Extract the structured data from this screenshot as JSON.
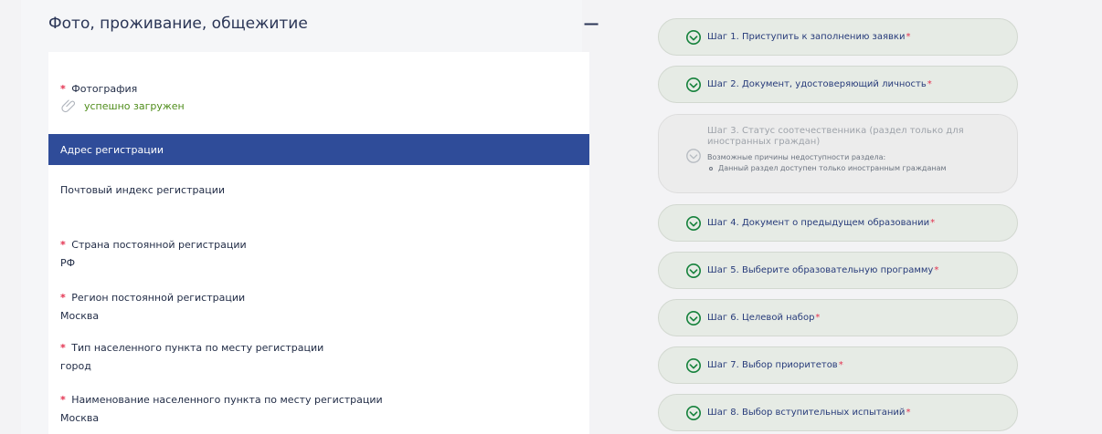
{
  "section": {
    "title": "Фото, проживание, общежитие",
    "collapse_symbol": "−"
  },
  "form": {
    "photo": {
      "label": "Фотография",
      "status": "успешно загружен"
    },
    "address_section": "Адрес регистрации",
    "postal_index": {
      "label": "Почтовый индекс регистрации"
    },
    "country": {
      "label": "Страна постоянной регистрации",
      "value": "РФ"
    },
    "region": {
      "label": "Регион постоянной регистрации",
      "value": "Москва"
    },
    "city_type": {
      "label": "Тип населенного пункта по месту регистрации",
      "value": "город"
    },
    "city_name": {
      "label": "Наименование населенного пункта по месту регистрации",
      "value": "Москва"
    }
  },
  "steps": [
    {
      "label": "Шаг 1. Приступить к заполнению заявки",
      "required": "*"
    },
    {
      "label": "Шаг 2. Документ, удостоверяющий личность",
      "required": "*"
    },
    {
      "line1": "Шаг 3. Статус соотечественника (раздел только для",
      "line2": "иностранных граждан)",
      "reasons_title": "Возможные причины недоступности раздела:",
      "reason": "Данный раздел доступен только иностранным гражданам"
    },
    {
      "label": "Шаг 4. Документ о предыдущем образовании",
      "required": "*"
    },
    {
      "label": "Шаг 5. Выберите образовательную программу",
      "required": "*"
    },
    {
      "label": "Шаг 6. Целевой набор",
      "required": "*"
    },
    {
      "label": "Шаг 7. Выбор приоритетов",
      "required": "*"
    },
    {
      "label": "Шаг 8. Выбор вступительных испытаний",
      "required": "*"
    }
  ],
  "icons": {
    "attachment": "paperclip-icon",
    "step_check": "check-circle-icon"
  },
  "colors": {
    "primary": "#2f4c99",
    "required": "#e3314f",
    "success": "#4f8d1b",
    "step_background": "#e6ebe5"
  }
}
